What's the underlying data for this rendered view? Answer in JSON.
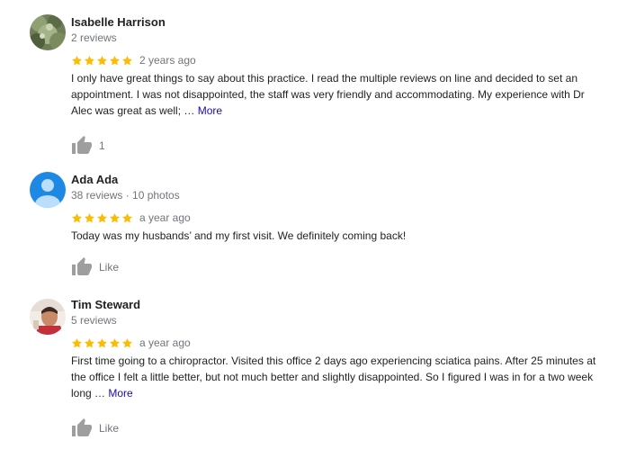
{
  "reviews": [
    {
      "name": "Isabelle Harrison",
      "meta": "2 reviews",
      "rating": 5,
      "time": "2 years ago",
      "text": "I only have great things to say about this practice. I read the multiple reviews on line and decided to set an appointment. I was not disappointed, the staff was very friendly and accommodating. My experience with Dr Alec was great as well; … ",
      "more": "More",
      "like_label": "1",
      "avatar": "nature-photo-avatar"
    },
    {
      "name": "Ada Ada",
      "meta": "38 reviews · 10 photos",
      "rating": 5,
      "time": "a year ago",
      "text": "Today was my husbands’ and my first  visit. We definitely coming back!",
      "more": "",
      "like_label": "Like",
      "avatar": "default-person-avatar"
    },
    {
      "name": "Tim Steward",
      "meta": "5 reviews",
      "rating": 5,
      "time": "a year ago",
      "text": "First time going to a chiropractor. Visited this office 2 days ago experiencing sciatica pains. After 25 minutes at the office I felt a little better, but not much better and slightly disappointed. So I figured I was in for a two week long … ",
      "more": "More",
      "like_label": "Like",
      "avatar": "person-photo-avatar"
    }
  ],
  "colors": {
    "star": "#fbbc04",
    "link": "#1a0dab",
    "muted": "#70757a",
    "like_icon": "#9e9e9e",
    "default_avatar": "#1e88e5"
  }
}
